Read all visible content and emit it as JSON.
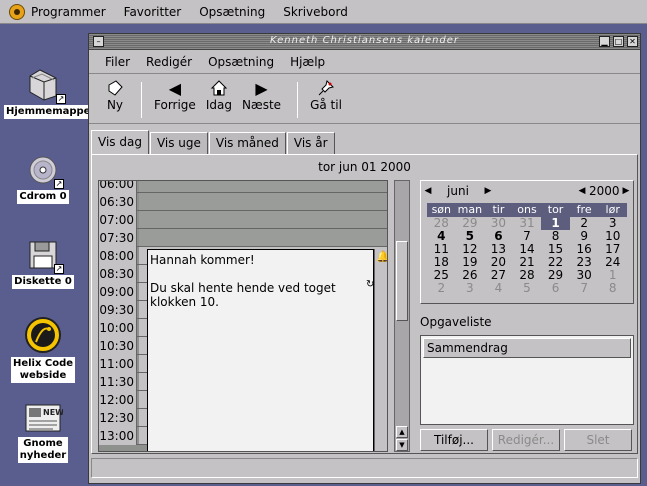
{
  "panel": {
    "items": [
      "Programmer",
      "Favoritter",
      "Opsætning",
      "Skrivebord"
    ]
  },
  "desktop": {
    "icons": [
      {
        "label": "Hjemmemappe",
        "icon": "folder-icon"
      },
      {
        "label": "Cdrom 0",
        "icon": "cdrom-icon"
      },
      {
        "label": "Diskette 0",
        "icon": "floppy-icon"
      },
      {
        "label": "Helix Code webside",
        "label1": "Helix Code",
        "label2": "webside",
        "icon": "helix-code-icon"
      },
      {
        "label": "Gnome nyheder",
        "label1": "Gnome",
        "label2": "nyheder",
        "icon": "newspaper-icon"
      }
    ]
  },
  "window": {
    "title": "Kenneth Christiansens kalender",
    "menu": [
      "Filer",
      "Redigér",
      "Opsætning",
      "Hjælp"
    ],
    "toolbar": {
      "new": "Ny",
      "prev": "Forrige",
      "today": "Idag",
      "next": "Næste",
      "goto": "Gå til"
    },
    "tabs": [
      "Vis dag",
      "Vis uge",
      "Vis måned",
      "Vis år"
    ],
    "date_heading": "tor jun 01 2000",
    "hours": [
      "06:00",
      "06:30",
      "07:00",
      "07:30",
      "08:00",
      "08:30",
      "09:00",
      "09:30",
      "10:00",
      "10:30",
      "11:00",
      "11:30",
      "12:00",
      "12:30",
      "13:00"
    ],
    "event": {
      "title": "Hannah kommer!",
      "line1": "Du skal hente hende ved toget",
      "line2": "klokken 10."
    },
    "minical": {
      "month": "juni",
      "year": "2000",
      "weekdays": [
        "søn",
        "man",
        "tir",
        "ons",
        "tor",
        "fre",
        "lør"
      ],
      "days": [
        "28",
        "29",
        "30",
        "31",
        "1",
        "2",
        "3",
        "4",
        "5",
        "6",
        "7",
        "8",
        "9",
        "10",
        "11",
        "12",
        "13",
        "14",
        "15",
        "16",
        "17",
        "18",
        "19",
        "20",
        "21",
        "22",
        "23",
        "24",
        "25",
        "26",
        "27",
        "28",
        "29",
        "30",
        "1",
        "2",
        "3",
        "4",
        "5",
        "6",
        "7",
        "8"
      ]
    },
    "tasks": {
      "label": "Opgaveliste",
      "header": "Sammendrag",
      "add": "Tilføj...",
      "edit": "Redigér...",
      "delete": "Slet"
    }
  },
  "colors": {
    "desktop": "#5a5e8f",
    "chrome": "#c5c2c5",
    "cal_header": "#5d5d7d"
  }
}
